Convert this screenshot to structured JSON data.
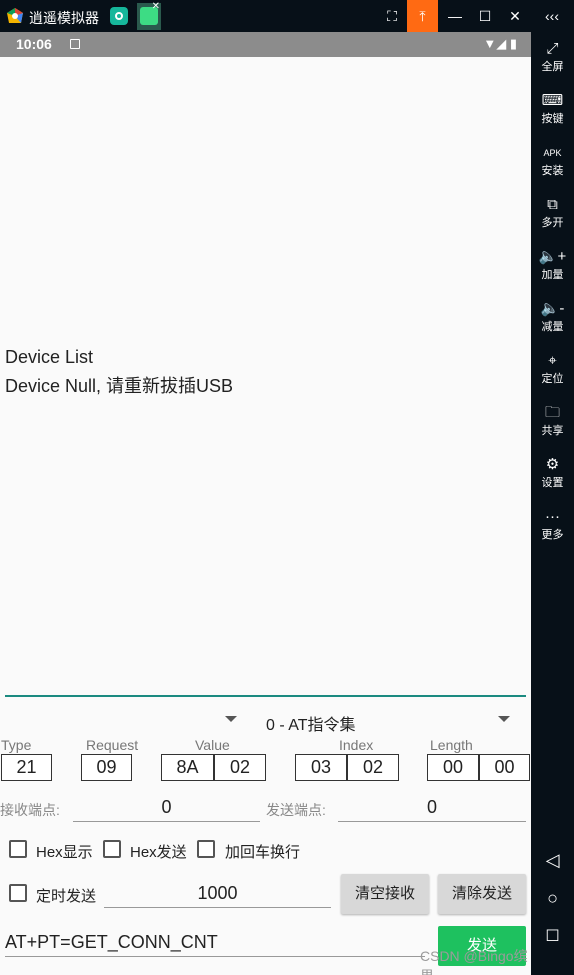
{
  "window": {
    "title": "逍遥模拟器",
    "title_buttons": [
      "screenshot-icon",
      "upload-icon",
      "minimize-icon",
      "maximize-icon",
      "close-icon",
      "collapse-icon"
    ]
  },
  "status_bar": {
    "time": "10:06"
  },
  "sidebar": {
    "items": [
      {
        "label": "全屏",
        "icon": "fullscreen-icon"
      },
      {
        "label": "按键",
        "icon": "keyboard-icon"
      },
      {
        "label": "安装",
        "icon": "apk-icon"
      },
      {
        "label": "多开",
        "icon": "multi-icon"
      },
      {
        "label": "加量",
        "icon": "volume-up-icon"
      },
      {
        "label": "减量",
        "icon": "volume-down-icon"
      },
      {
        "label": "定位",
        "icon": "location-icon"
      },
      {
        "label": "共享",
        "icon": "folder-icon"
      },
      {
        "label": "设置",
        "icon": "gear-icon"
      },
      {
        "label": "更多",
        "icon": "more-icon"
      }
    ]
  },
  "device": {
    "line1": "Device List",
    "line2": "Device Null, 请重新拔插USB"
  },
  "command_set": {
    "selected": "0 - AT指令集"
  },
  "request_fields": {
    "type_label": "Type",
    "request_label": "Request",
    "value_label": "Value",
    "index_label": "Index",
    "length_label": "Length",
    "type": "21",
    "request": "09",
    "value_hi": "8A",
    "value_lo": "02",
    "index_hi": "03",
    "index_lo": "02",
    "length_hi": "00",
    "length_lo": "00"
  },
  "endpoints": {
    "recv_label": "接收端点:",
    "recv_value": "0",
    "send_label": "发送端点:",
    "send_value": "0"
  },
  "options": {
    "hex_display": "Hex显示",
    "hex_send": "Hex发送",
    "crlf": "加回车换行",
    "timed_send": "定时发送",
    "interval": "1000"
  },
  "buttons": {
    "clear_recv": "清空接收",
    "clear_send": "清除发送",
    "send": "发送"
  },
  "send_input": {
    "value": "AT+PT=GET_CONN_CNT"
  },
  "watermark": "CSDN @Bingo缤果"
}
